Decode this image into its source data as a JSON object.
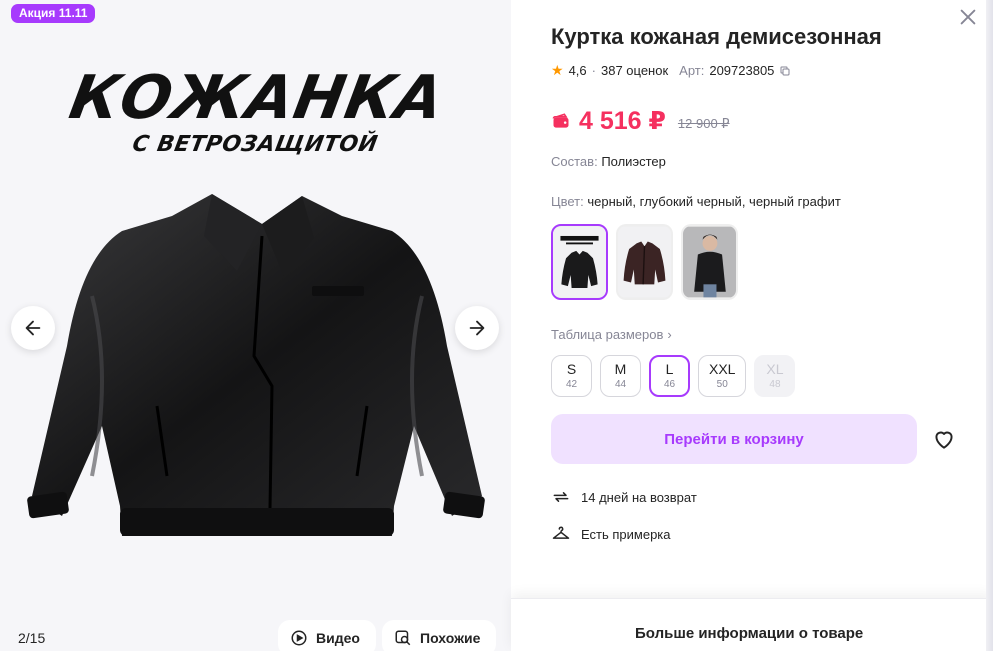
{
  "gallery": {
    "promo_badge": "Акция 11.11",
    "image_headline": "КОЖАНКА",
    "image_subheadline": "С ВЕТРОЗАЩИТОЙ",
    "counter": "2/15",
    "video_label": "Видео",
    "similar_label": "Похожие"
  },
  "product": {
    "title": "Куртка кожаная демисезонная",
    "rating": "4,6",
    "reviews": "387 оценок",
    "article_label": "Арт:",
    "article": "209723805",
    "price": "4 516 ₽",
    "old_price": "12 900 ₽",
    "composition_label": "Состав:",
    "composition": "Полиэстер",
    "color_label": "Цвет:",
    "color": "черный, глубокий черный, черный графит",
    "size_table_label": "Таблица размеров",
    "sizes": [
      {
        "size": "S",
        "ru": "42",
        "state": "available"
      },
      {
        "size": "M",
        "ru": "44",
        "state": "available"
      },
      {
        "size": "L",
        "ru": "46",
        "state": "selected"
      },
      {
        "size": "XXL",
        "ru": "50",
        "state": "available"
      },
      {
        "size": "XL",
        "ru": "48",
        "state": "disabled"
      }
    ],
    "cart_button": "Перейти в корзину",
    "features": [
      "14 дней на возврат",
      "Есть примерка"
    ],
    "more_info": "Больше информации о товаре"
  },
  "colors": {
    "accent": "#a73afd",
    "accent_light": "#f0e1ff",
    "price": "#f5305f",
    "muted": "#868695",
    "star": "#ff9800"
  }
}
